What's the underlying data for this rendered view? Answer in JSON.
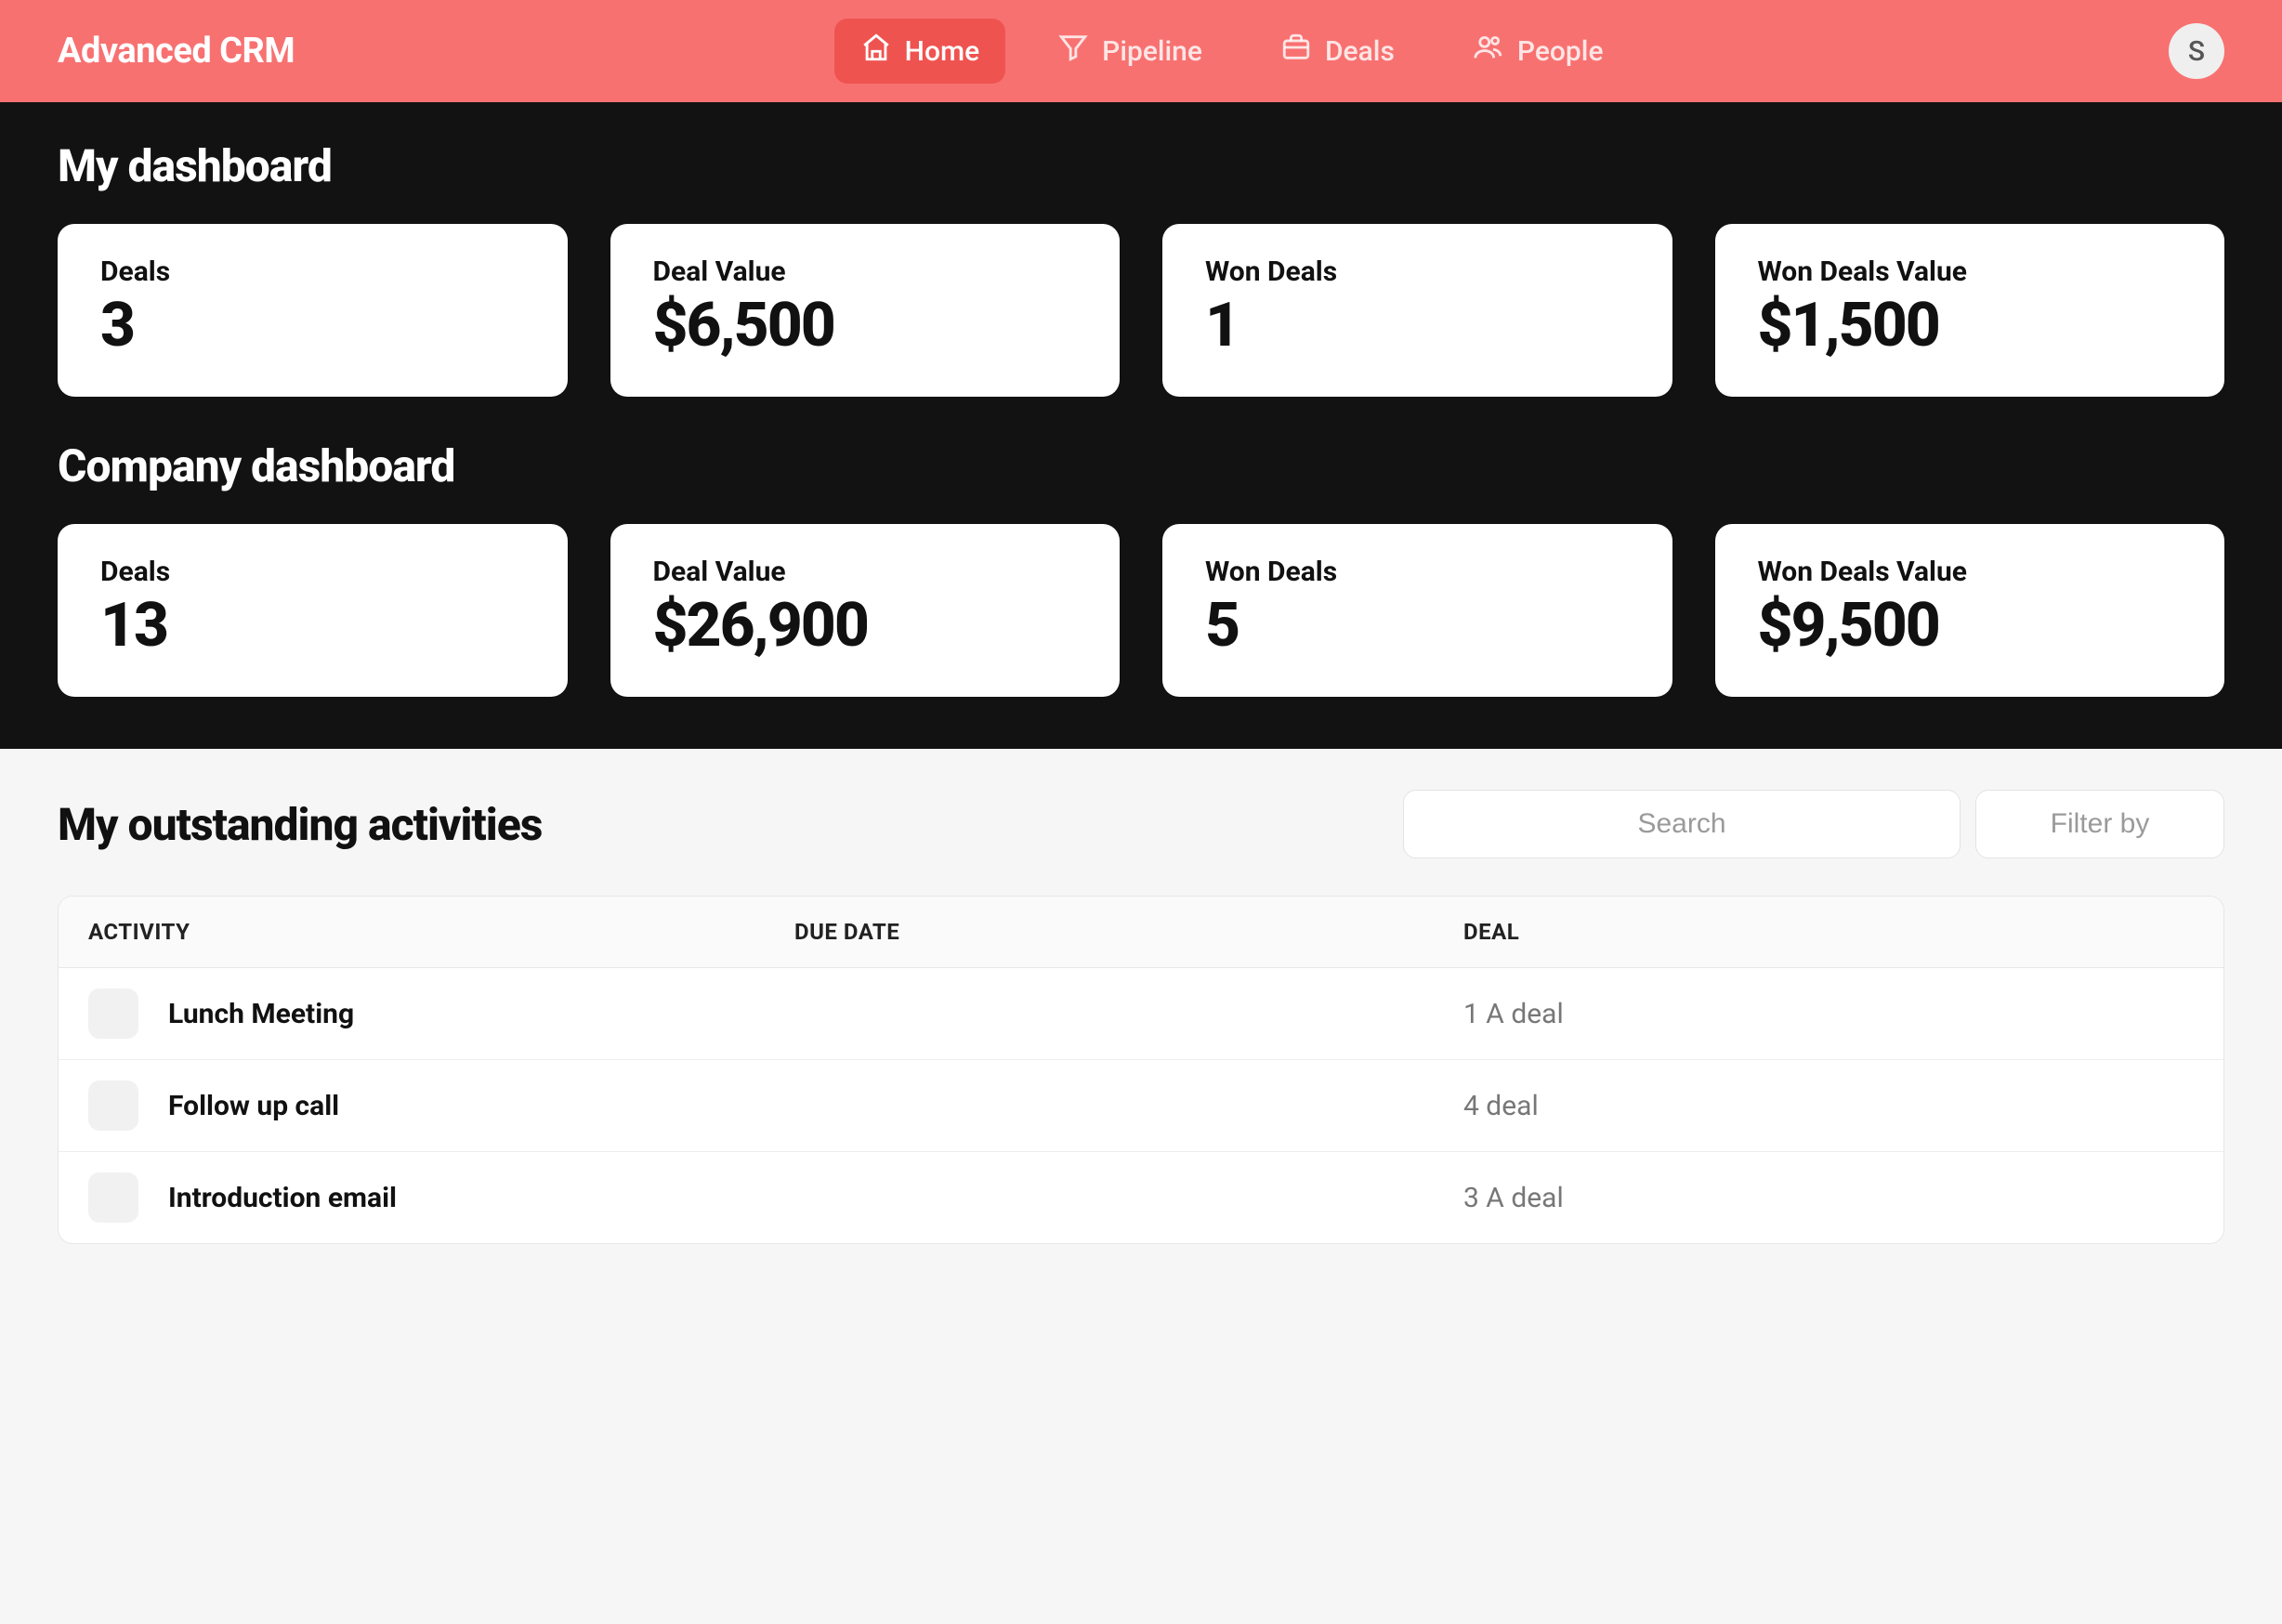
{
  "brand": "Advanced CRM",
  "nav": {
    "items": [
      {
        "id": "home",
        "label": "Home",
        "active": true
      },
      {
        "id": "pipeline",
        "label": "Pipeline",
        "active": false
      },
      {
        "id": "deals",
        "label": "Deals",
        "active": false
      },
      {
        "id": "people",
        "label": "People",
        "active": false
      }
    ]
  },
  "avatar_initial": "S",
  "dashboards": {
    "my": {
      "title": "My dashboard",
      "cards": [
        {
          "label": "Deals",
          "value": "3"
        },
        {
          "label": "Deal Value",
          "value": "$6,500"
        },
        {
          "label": "Won Deals",
          "value": "1"
        },
        {
          "label": "Won Deals Value",
          "value": "$1,500"
        }
      ]
    },
    "company": {
      "title": "Company dashboard",
      "cards": [
        {
          "label": "Deals",
          "value": "13"
        },
        {
          "label": "Deal Value",
          "value": "$26,900"
        },
        {
          "label": "Won Deals",
          "value": "5"
        },
        {
          "label": "Won Deals Value",
          "value": "$9,500"
        }
      ]
    }
  },
  "activities": {
    "title": "My outstanding activities",
    "search_placeholder": "Search",
    "filter_label": "Filter by",
    "columns": [
      "ACTIVITY",
      "DUE DATE",
      "DEAL"
    ],
    "rows": [
      {
        "activity": "Lunch Meeting",
        "due_date": "",
        "deal": "1 A deal"
      },
      {
        "activity": "Follow up call",
        "due_date": "",
        "deal": "4 deal"
      },
      {
        "activity": "Introduction email",
        "due_date": "",
        "deal": "3 A deal"
      }
    ]
  }
}
